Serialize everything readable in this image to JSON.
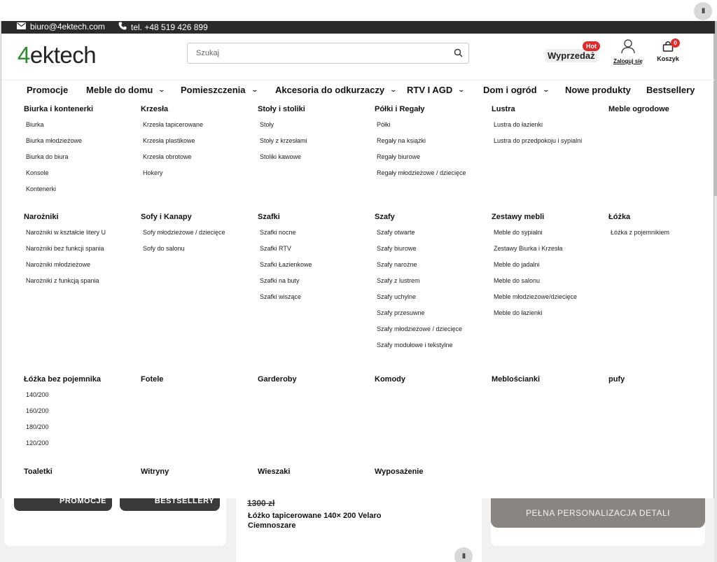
{
  "topbar": {
    "email": "biuro@4ektech.com",
    "phone": "tel. +48 519 426 899"
  },
  "header": {
    "logo_accent": "4",
    "logo_rest": "ektech",
    "search_placeholder": "Szukaj",
    "sale_label": "Wyprzedaż",
    "hot_badge": "Hot",
    "account_label": "Zaloguj się",
    "cart_label": "Koszyk",
    "cart_count": "0"
  },
  "nav": {
    "items": [
      {
        "label": "Promocje"
      },
      {
        "label": "Meble do domu"
      },
      {
        "label": "Pomieszczenia"
      },
      {
        "label": "Akcesoria do odkurzaczy"
      },
      {
        "label": "RTV I AGD"
      },
      {
        "label": "Dom i ogród"
      },
      {
        "label": "Nowe produkty"
      },
      {
        "label": "Bestsellery"
      }
    ]
  },
  "mega": {
    "row1": [
      {
        "title": "Biurka i kontenerki",
        "items": [
          "Biurka",
          "Biurka młodzieżowe",
          "Biurka do biura",
          "Konsole",
          "Kontenerki"
        ]
      },
      {
        "title": "Krzesła",
        "items": [
          "Krzesła tapicerowane",
          "Krzesła plastikowe",
          "Krzesła obrotowe",
          "Hokery"
        ]
      },
      {
        "title": "Stoły i stoliki",
        "items": [
          "Stoły",
          "Stoły z krzesłami",
          "Stoliki kawowe"
        ]
      },
      {
        "title": "Półki i Regały",
        "items": [
          "Półki",
          "Regały na książki",
          "Regały biurowe",
          "Regały młodzieżowe / dziecięce"
        ]
      },
      {
        "title": "Lustra",
        "items": [
          "Lustra do łazienki",
          "Lustra do przedpokoju i sypialni"
        ]
      },
      {
        "title": "Meble ogrodowe",
        "items": []
      }
    ],
    "row2": [
      {
        "title": "Narożniki",
        "items": [
          "Narożniki w kształcie litery U",
          "Narożniki bez funkcji spania",
          "Narożniki młodzieżowe",
          "Narożniki z funkcją spania"
        ]
      },
      {
        "title": "Sofy i Kanapy",
        "items": [
          "Sofy młodzieżowe / dziecięce",
          "Sofy do salonu"
        ]
      },
      {
        "title": "Szafki",
        "items": [
          "Szafki nocne",
          "Szafki RTV",
          "Szafki Łazienkowe",
          "Szafki na buty",
          "Szafki wiszące"
        ]
      },
      {
        "title": "Szafy",
        "items": [
          "Szafy otwarte",
          "Szafy biurowe",
          "Szafy narożne",
          "Szafy z lustrem",
          "Szafy uchylne",
          "Szafy przesuwne",
          "Szafy młodzieżowe / dziecięce",
          "Szafy modułowe i tekstylne"
        ]
      },
      {
        "title": "Zestawy mebli",
        "items": [
          "Meble do sypialni",
          "Zestawy Biurka i Krzesła",
          "Meble do jadalni",
          "Meble do salonu",
          "Meble młodzieżowe/dziecięce",
          "Meble do łazienki"
        ]
      },
      {
        "title": "Łóżka",
        "items": [
          "Łóżka z pojemnikiem"
        ]
      }
    ],
    "row3": [
      {
        "title": "Łóżka bez pojemnika",
        "items": [
          "140/200",
          "160/200",
          "180/200",
          "120/200"
        ]
      },
      {
        "title": "Fotele",
        "items": []
      },
      {
        "title": "Garderoby",
        "items": []
      },
      {
        "title": "Komody",
        "items": []
      },
      {
        "title": "Meblościanki",
        "items": []
      },
      {
        "title": "pufy",
        "items": []
      }
    ],
    "row4": [
      {
        "title": "Toaletki",
        "items": []
      },
      {
        "title": "Witryny",
        "items": []
      },
      {
        "title": "Wieszaki",
        "items": []
      },
      {
        "title": "Wyposażenie",
        "items": []
      }
    ]
  },
  "below": {
    "tile1": "PROMOCJE",
    "tile2": "BESTSELLERY",
    "old_price": "1300 zł",
    "product_name": "Łóżko tapicerowane 140× 200 Velaro Ciemnoszare",
    "banner": "PEŁNA PERSONALIZACJA DETALI"
  },
  "controls": {
    "pause": "II"
  }
}
